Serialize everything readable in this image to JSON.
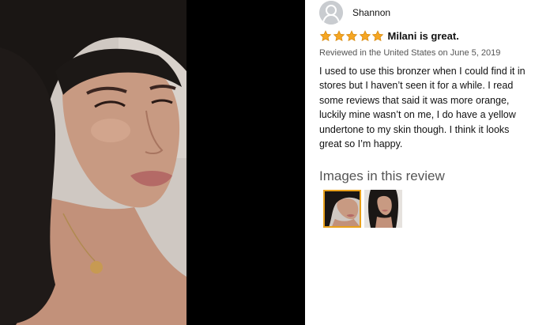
{
  "review": {
    "reviewer_name": "Shannon",
    "rating": 5,
    "rating_max": 5,
    "title": "Milani is great.",
    "meta": "Reviewed in the United States on June 5, 2019",
    "body": "I used to use this bronzer when I could find it in stores but I haven’t seen it for a while. I read some reviews that said it was more orange, luckily mine wasn’t on me, I do have a yellow undertone to my skin though. I think it looks great so I’m happy."
  },
  "images_section": {
    "heading": "Images in this review",
    "thumbnails": [
      {
        "icon": "review-photo-1",
        "selected": true
      },
      {
        "icon": "review-photo-2",
        "selected": false
      }
    ]
  },
  "colors": {
    "star": "#f5a623",
    "selected_border": "#e8a01a",
    "photo_background": "#000000"
  }
}
